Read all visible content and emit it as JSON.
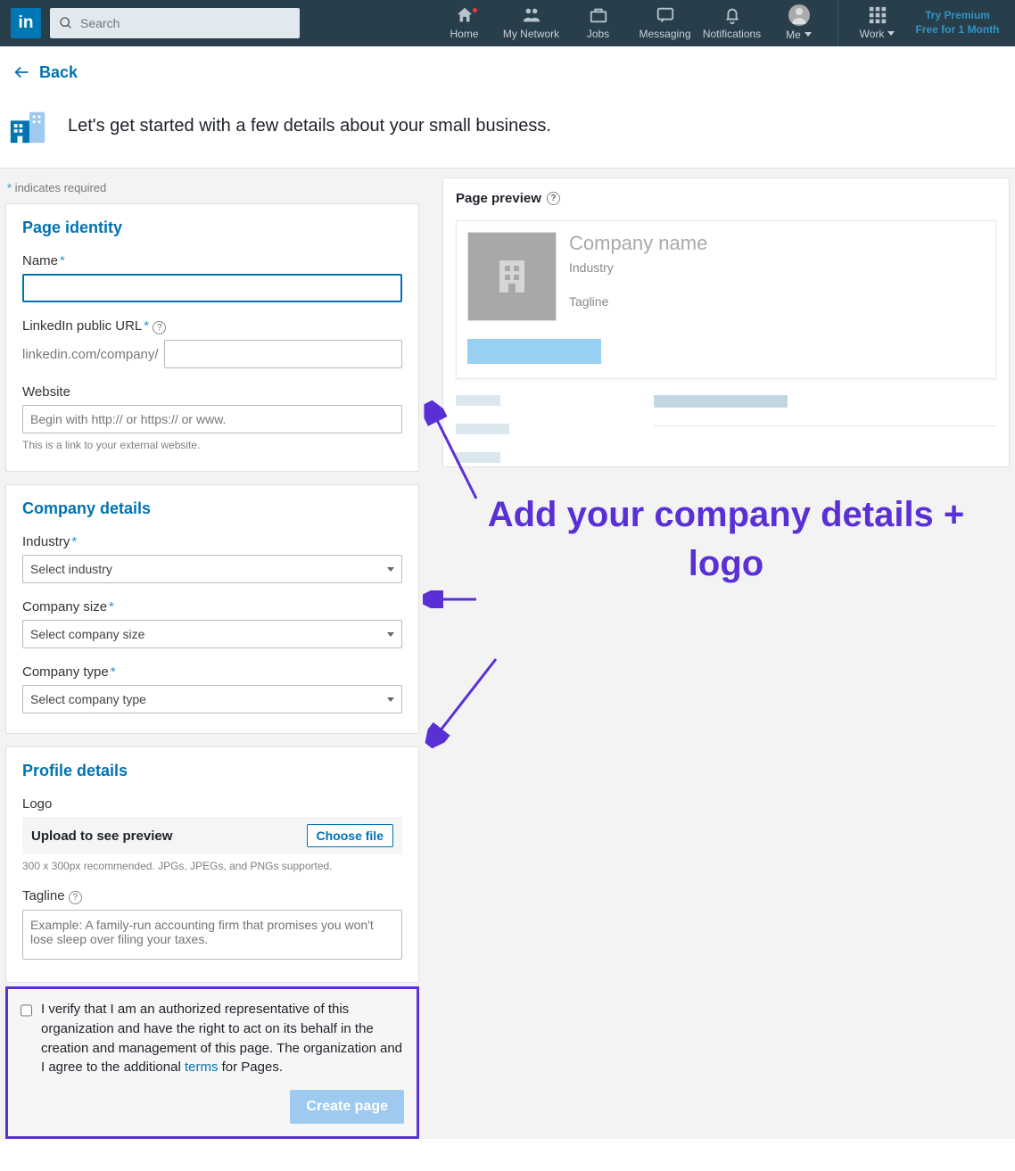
{
  "nav": {
    "searchPlaceholder": "Search",
    "home": "Home",
    "network": "My Network",
    "jobs": "Jobs",
    "messaging": "Messaging",
    "notifications": "Notifications",
    "me": "Me",
    "work": "Work",
    "premium1": "Try Premium",
    "premium2": "Free for 1 Month"
  },
  "back": "Back",
  "intro": "Let's get started with a few details about your small business.",
  "reqPrefix": "*",
  "reqText": " indicates required",
  "identity": {
    "heading": "Page identity",
    "nameLabel": "Name",
    "urlLabel": "LinkedIn public URL",
    "urlPrefix": "linkedin.com/company/",
    "websiteLabel": "Website",
    "websitePlaceholder": "Begin with http:// or https:// or www.",
    "websiteHelper": "This is a link to your external website."
  },
  "company": {
    "heading": "Company details",
    "industryLabel": "Industry",
    "industryPlaceholder": "Select industry",
    "sizeLabel": "Company size",
    "sizePlaceholder": "Select company size",
    "typeLabel": "Company type",
    "typePlaceholder": "Select company type"
  },
  "profile": {
    "heading": "Profile details",
    "logoLabel": "Logo",
    "uploadText": "Upload to see preview",
    "chooseFile": "Choose file",
    "logoHelper": "300 x 300px recommended. JPGs, JPEGs, and PNGs supported.",
    "taglineLabel": "Tagline",
    "taglinePlaceholder": "Example: A family-run accounting firm that promises you won't lose sleep over filing your taxes."
  },
  "verify": {
    "text1": "I verify that I am an authorized representative of this organization and have the right to act on its behalf in the creation and management of this page. The organization and I agree to the additional ",
    "termsLink": "terms",
    "text2": " for Pages."
  },
  "createBtn": "Create page",
  "preview": {
    "title": "Page preview",
    "companyName": "Company name",
    "industry": "Industry",
    "tagline": "Tagline"
  },
  "annotation": "Add your company details + logo"
}
